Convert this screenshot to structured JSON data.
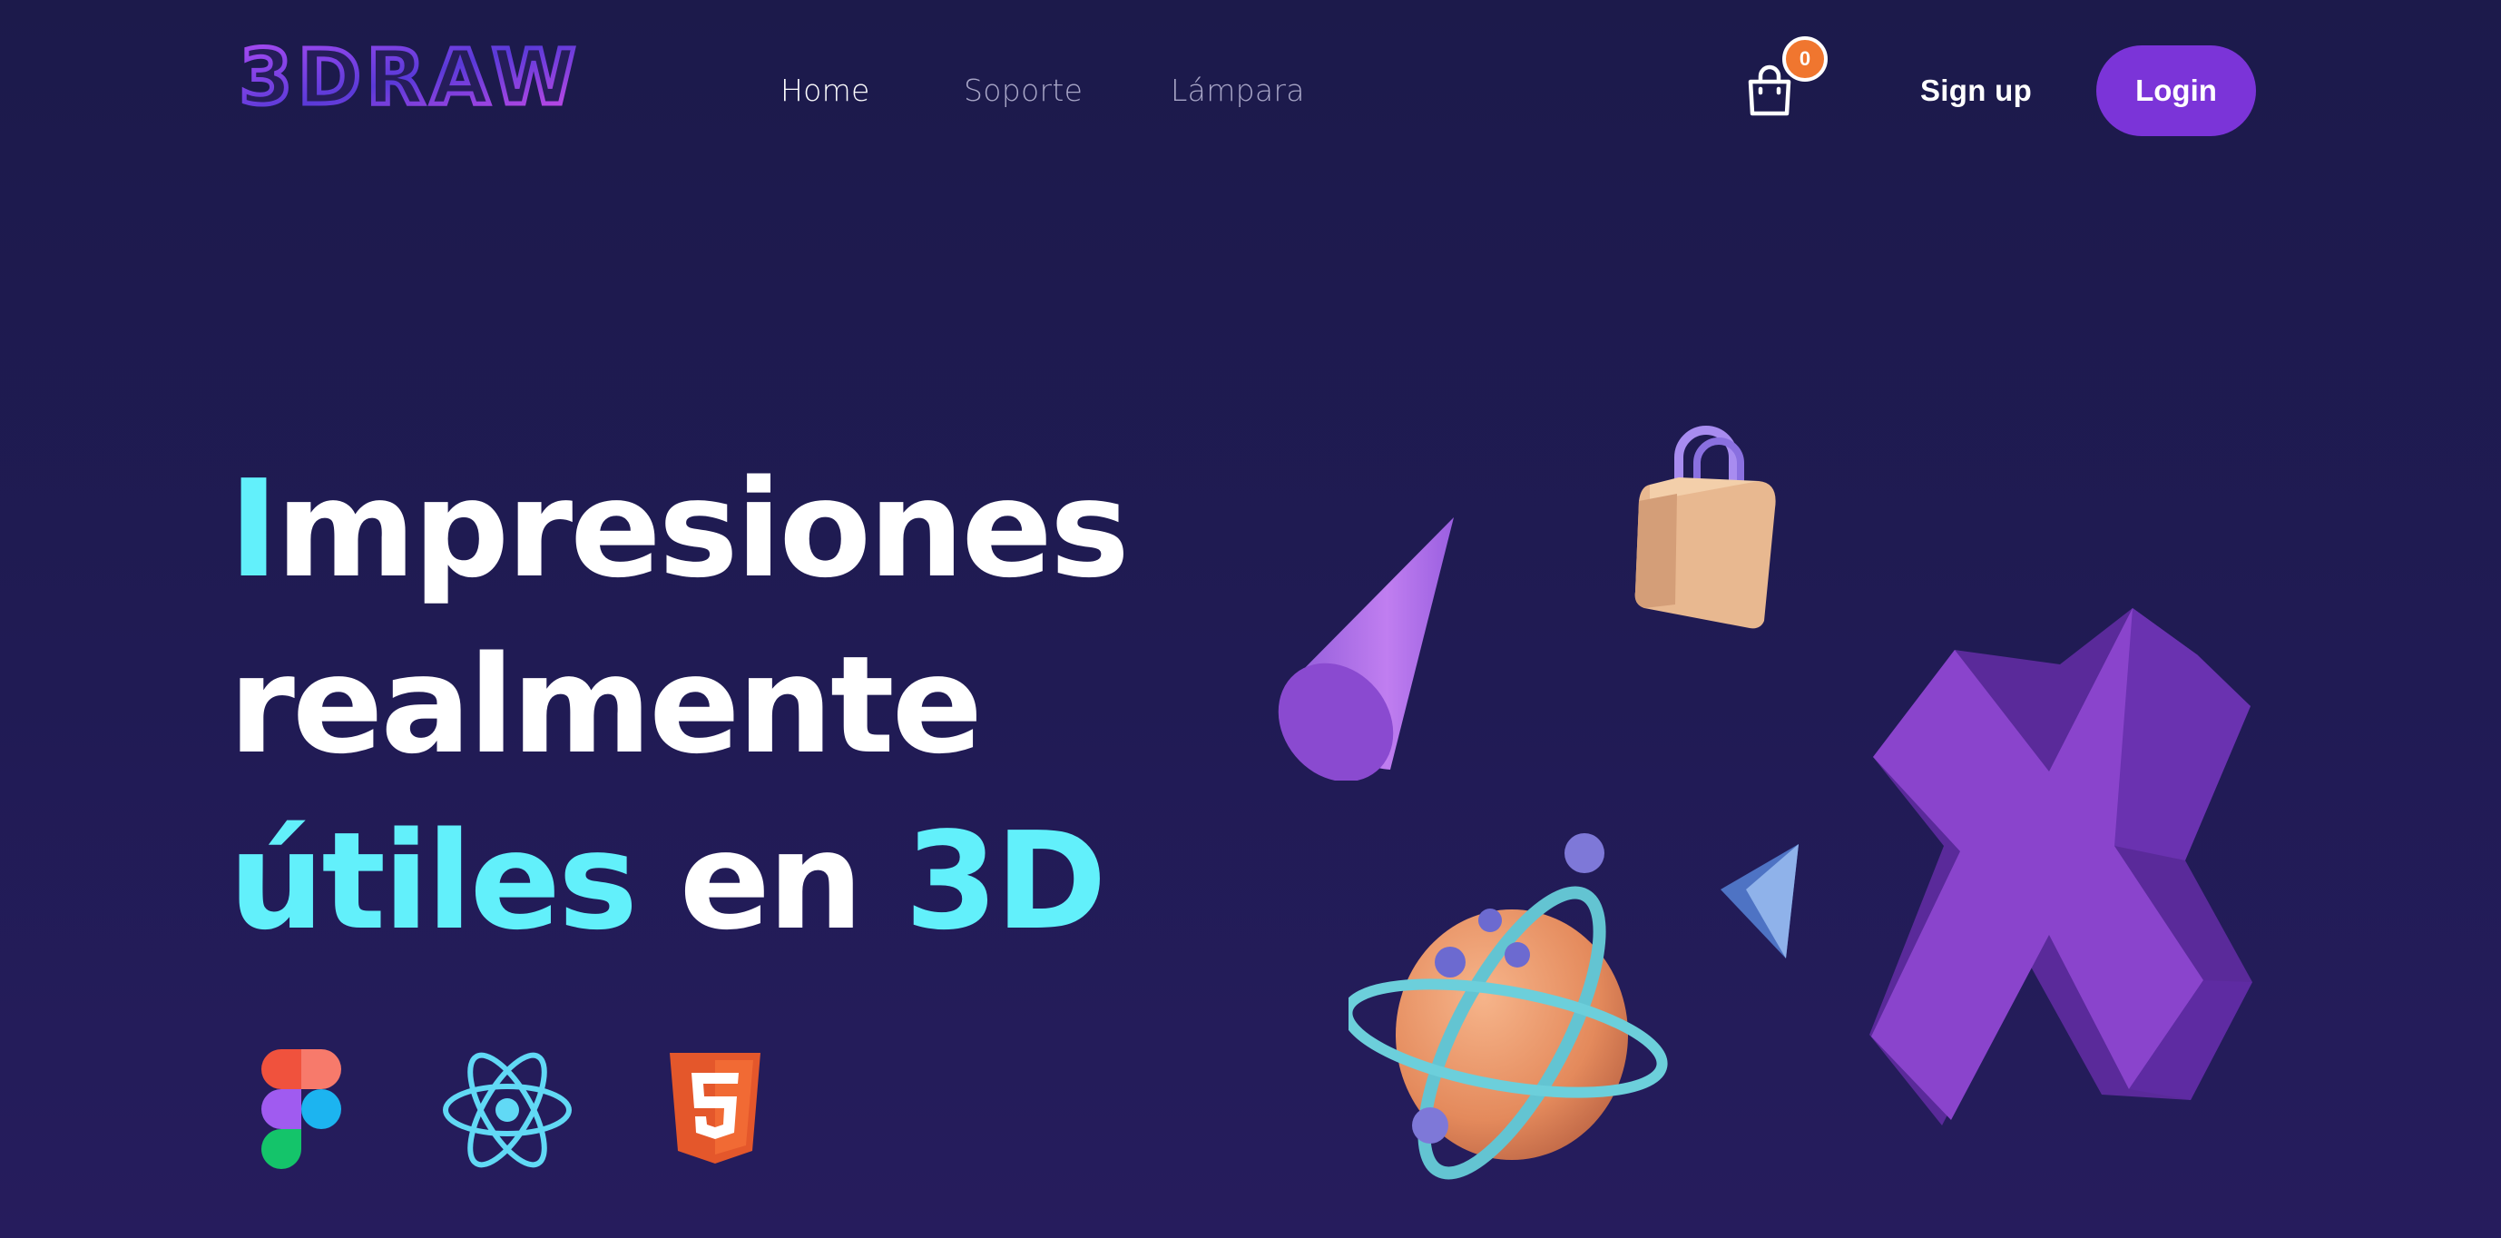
{
  "brand": {
    "logo_text": "3DRAW"
  },
  "nav": {
    "items": [
      {
        "label": "Home",
        "active": true
      },
      {
        "label": "Soporte",
        "active": false
      },
      {
        "label": "Lámpara",
        "active": false
      }
    ]
  },
  "cart": {
    "count": "0",
    "icon": "shopping-bag-icon"
  },
  "auth": {
    "signup_label": "Sign up",
    "login_label": "Login"
  },
  "hero": {
    "line1_first": "I",
    "line1_rest": "mpresiones",
    "line2": "realmente",
    "line3_a": "útiles",
    "line3_b": " en ",
    "line3_c": "3D"
  },
  "tech_icons": [
    "figma-icon",
    "react-icon",
    "html5-icon"
  ],
  "illustrations": [
    "cone-3d",
    "shopping-bag-3d",
    "planet-3d",
    "triangle-3d",
    "x-shape-3d"
  ],
  "colors": {
    "background": "#1c1a4b",
    "accent_cyan": "#62f0fb",
    "login_button": "#7b34d8",
    "badge": "#f0762f",
    "nav_inactive": "#a9a7c8"
  }
}
